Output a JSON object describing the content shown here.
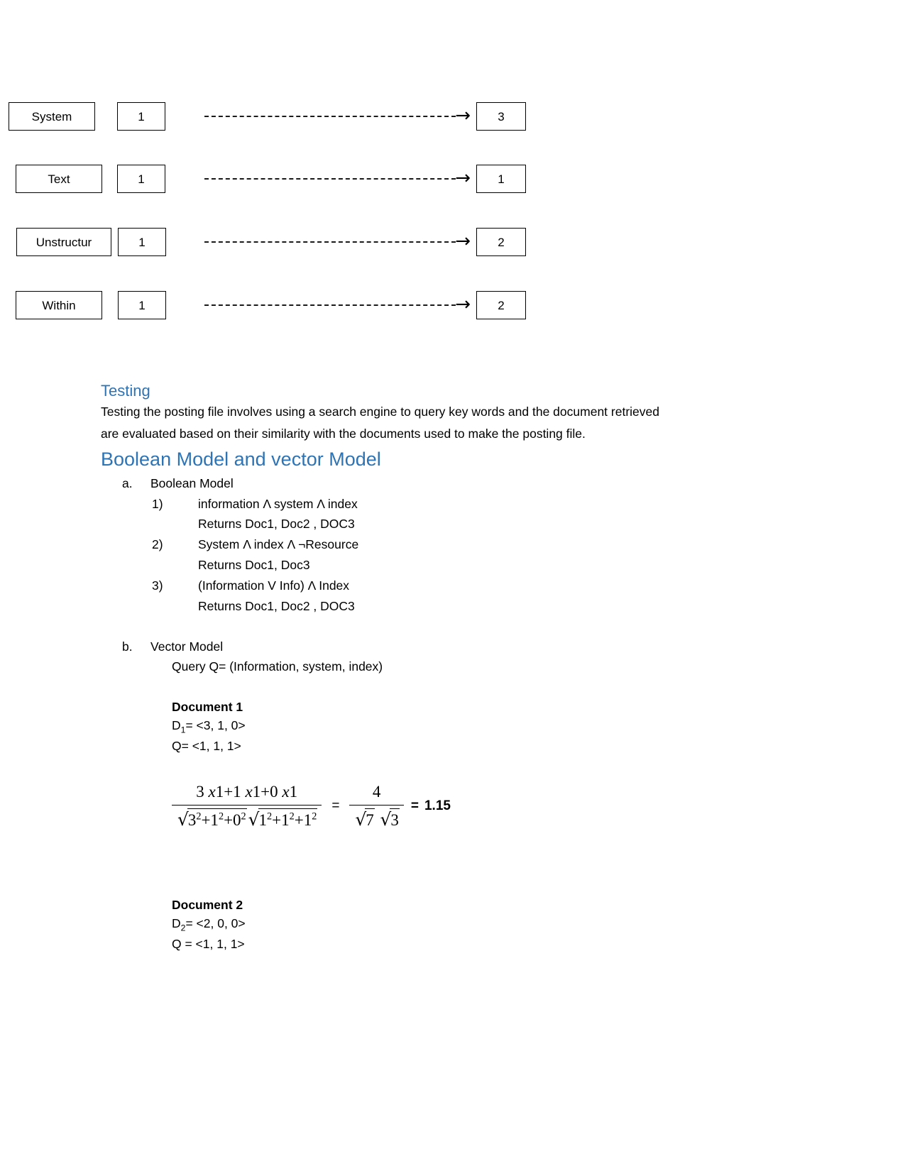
{
  "diagram": {
    "rows": [
      {
        "term": "System",
        "count": "1",
        "target": "3"
      },
      {
        "term": "Text",
        "count": "1",
        "target": "1"
      },
      {
        "term": "Unstructur",
        "count": "1",
        "target": "2"
      },
      {
        "term": "Within",
        "count": "1",
        "target": "2"
      }
    ],
    "arrow_glyph": "→"
  },
  "testing": {
    "heading": "Testing",
    "paragraph_line1": "Testing the posting file involves using a search engine to query key words and the document retrieved",
    "paragraph_line2": "are evaluated based on their similarity with the documents used to make the posting file."
  },
  "models": {
    "heading": "Boolean Model and vector Model",
    "boolean": {
      "marker": "a.",
      "label": "Boolean Model",
      "queries": [
        {
          "marker": "1)",
          "expression": "information Λ system Λ index",
          "returns": "Returns Doc1, Doc2 , DOC3"
        },
        {
          "marker": "2)",
          "expression": "System Λ index Λ ¬Resource",
          "returns": "Returns Doc1, Doc3"
        },
        {
          "marker": "3)",
          "expression": "(Information V Info) Λ Index",
          "returns": "Returns Doc1, Doc2 , DOC3"
        }
      ]
    },
    "vector": {
      "marker": "b.",
      "label": "Vector  Model",
      "query": "Query Q= (Information, system, index)",
      "documents": [
        {
          "title": "Document 1",
          "doc_vector_label": "D",
          "doc_vector_sub": "1",
          "doc_vector_value": "= <3, 1, 0>",
          "query_vector": "Q= <1, 1, 1>"
        },
        {
          "title": "Document 2",
          "doc_vector_label": "D",
          "doc_vector_sub": "2",
          "doc_vector_value": "= <2, 0, 0>",
          "query_vector": "Q = <1, 1, 1>"
        }
      ],
      "formula": {
        "numerator_a": "3 ",
        "numerator_x1": "x",
        "numerator_b": "1+1 ",
        "numerator_x2": "x",
        "numerator_c": "1+0 ",
        "numerator_x3": "x",
        "numerator_d": "1",
        "radical_sign": "√",
        "den_first_body": "3",
        "den_first_rest": "+1",
        "den_first_rest2": "+0",
        "exp_two": "2",
        "den_second_body": "1",
        "den_second_rest": "+1",
        "den_second_rest2": "+1",
        "equals_1": "=",
        "simple_numerator": "4",
        "simple_den_a": "7",
        "simple_den_b": "3",
        "equals_2": "=",
        "result": "1.15"
      }
    }
  }
}
